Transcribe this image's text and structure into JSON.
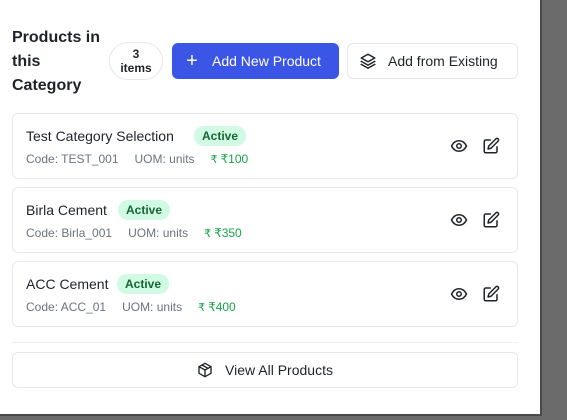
{
  "section": {
    "title": "Products in this Category",
    "count_number": "3",
    "count_unit": "items",
    "add_new_label": "Add New Product",
    "add_existing_label": "Add from Existing",
    "view_all_label": "View All Products"
  },
  "products": [
    {
      "name": "Test Category Selection",
      "status": "Active",
      "code": "Code: TEST_001",
      "uom": "UOM: units",
      "price": "₹100"
    },
    {
      "name": "Birla Cement",
      "status": "Active",
      "code": "Code: Birla_001",
      "uom": "UOM: units",
      "price": "₹350"
    },
    {
      "name": "ACC Cement",
      "status": "Active",
      "code": "Code: ACC_01",
      "uom": "UOM: units",
      "price": "₹400"
    }
  ],
  "icons": {
    "add": "plus-icon",
    "add_existing": "layers-icon",
    "view": "eye-icon",
    "edit": "edit-icon",
    "currency": "rupee-icon",
    "view_all": "package-icon"
  },
  "colors": {
    "primary": "#3b55e6",
    "status_bg": "#d1fae5",
    "status_text": "#166534",
    "price": "#16a34a"
  }
}
